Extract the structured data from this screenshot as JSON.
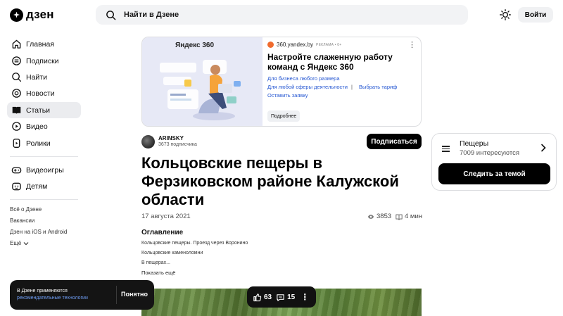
{
  "header": {
    "logo_text": "дзен",
    "search_placeholder": "Найти в Дзене",
    "login_label": "Войти"
  },
  "sidebar": {
    "items": [
      {
        "label": "Главная",
        "icon": "home-icon"
      },
      {
        "label": "Подписки",
        "icon": "subscriptions-icon"
      },
      {
        "label": "Найти",
        "icon": "search-icon"
      },
      {
        "label": "Новости",
        "icon": "news-icon"
      },
      {
        "label": "Статьи",
        "icon": "articles-icon",
        "active": true
      },
      {
        "label": "Видео",
        "icon": "video-icon"
      },
      {
        "label": "Ролики",
        "icon": "shorts-icon"
      },
      {
        "label": "Видеоигры",
        "icon": "gamepad-icon"
      },
      {
        "label": "Детям",
        "icon": "kids-icon"
      }
    ],
    "footer_links": [
      "Всё о Дзене",
      "Вакансии",
      "Дзен на iOS и Android",
      "Ещё"
    ]
  },
  "ad": {
    "brand": "Яндекс 360",
    "domain": "360.yandex.by",
    "tag": "РЕКЛАМА • 0+",
    "title": "Настройте слаженную работу команд с Яндекс 360",
    "link1": "Для бизнеса любого размера",
    "link2": "Для любой сферы деятельности",
    "separator": "|",
    "link3": "Выбрать тариф",
    "link4": "Оставить заявку",
    "button": "Подробнее"
  },
  "author": {
    "name": "ARINSKY",
    "subscribers": "3673 подписчика",
    "subscribe_label": "Подписаться"
  },
  "article": {
    "title": "Кольцовские пещеры в Ферзиковском районе Калужской области",
    "date": "17 августа 2021",
    "views": "3853",
    "read_time": "4 мин",
    "toc_title": "Оглавление",
    "toc_items": [
      "Кольцовские пещеры. Проезд через Воронино",
      "Кольцовские каменоломни",
      "В пещерах..."
    ],
    "toc_more": "Показать ещё"
  },
  "reactions": {
    "likes": "63",
    "comments": "15"
  },
  "toast": {
    "text": "В Дзене применяются",
    "link": "рекомендательные технологии",
    "button": "Понятно"
  },
  "topic": {
    "name": "Пещеры",
    "count": "7009 интересуются",
    "follow_label": "Следить за темой"
  }
}
